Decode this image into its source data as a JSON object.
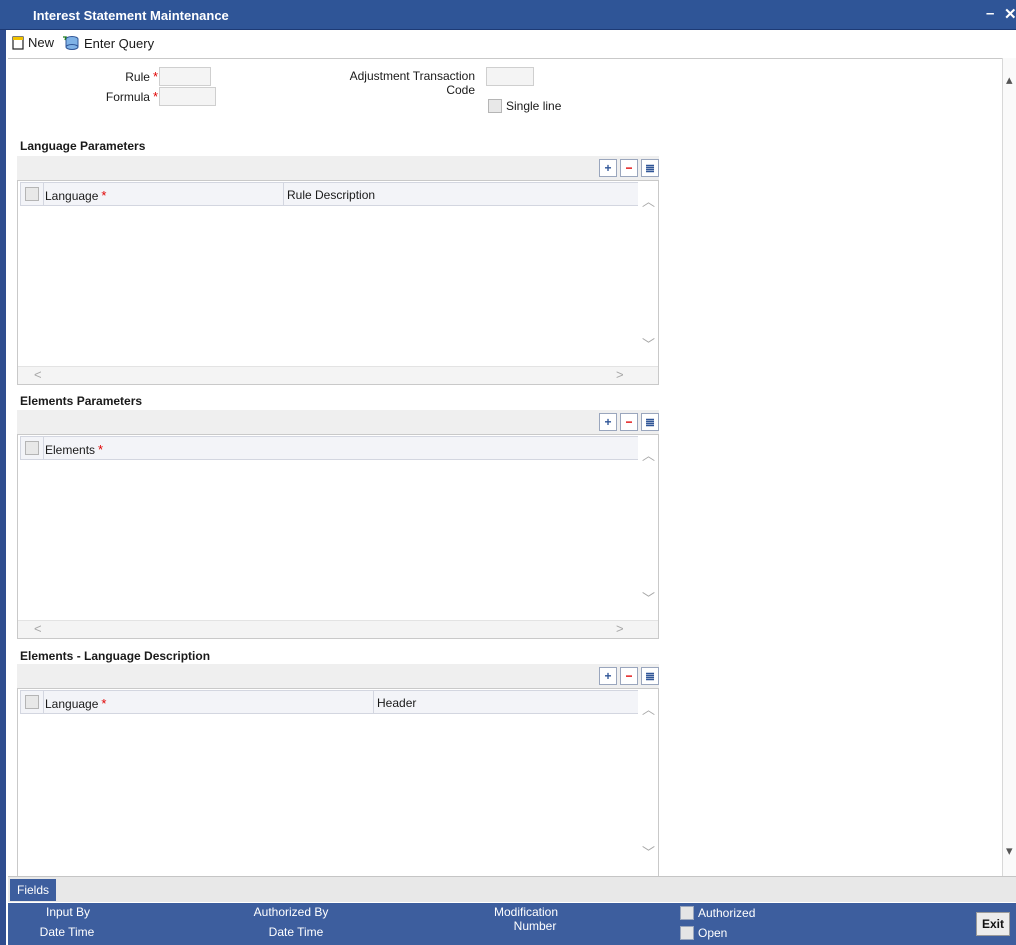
{
  "window": {
    "title": "Interest Statement Maintenance",
    "minimize": "–",
    "close": "✕"
  },
  "toolbar": {
    "new_label": "New",
    "enter_query_label": "Enter Query"
  },
  "header": {
    "rule_label": "Rule",
    "formula_label": "Formula",
    "adjustment_label_line1": "Adjustment Transaction",
    "adjustment_label_line2": "Code",
    "single_line_label": "Single line",
    "required_mark": "*"
  },
  "language_parameters": {
    "title": "Language Parameters",
    "columns": [
      "Language",
      "Rule Description"
    ]
  },
  "elements_parameters": {
    "title": "Elements Parameters",
    "columns": [
      "Elements"
    ]
  },
  "elements_language_description": {
    "title": "Elements - Language Description",
    "columns": [
      "Language",
      "Header"
    ]
  },
  "grid_buttons": {
    "add": "+",
    "remove": "−",
    "view": "≣"
  },
  "footer": {
    "fields_label": "Fields",
    "input_by": "Input By",
    "date_time_1": "Date Time",
    "authorized_by": "Authorized By",
    "date_time_2": "Date Time",
    "modification_line1": "Modification",
    "modification_line2": "Number",
    "authorized_label": "Authorized",
    "open_label": "Open",
    "exit_label": "Exit"
  },
  "colors": {
    "title_bar": "#2f5597",
    "footer": "#3d5e9e",
    "required": "#e00000"
  }
}
